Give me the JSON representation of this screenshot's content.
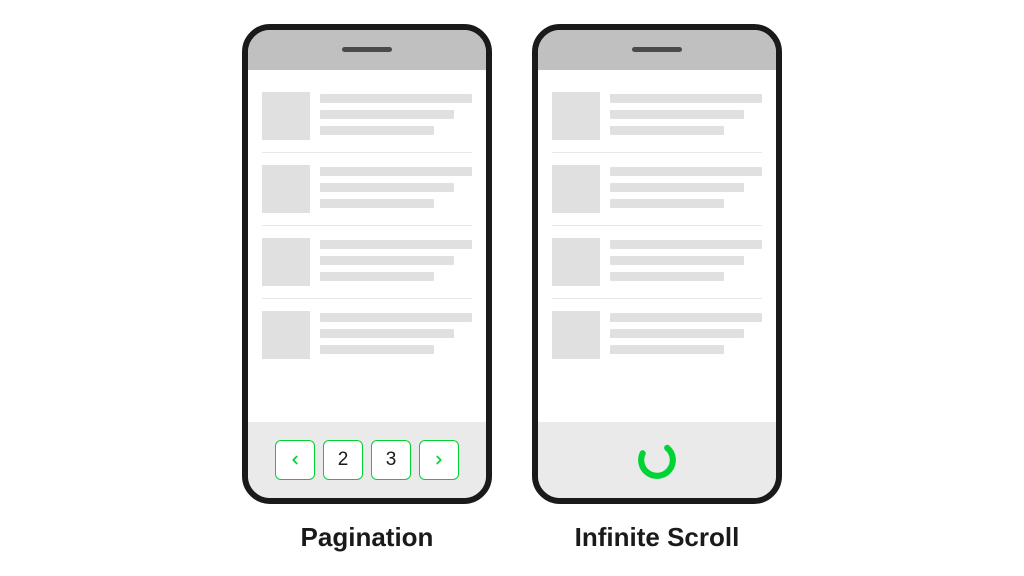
{
  "phones": {
    "pagination": {
      "label": "Pagination",
      "pages": {
        "page2": "2",
        "page3": "3"
      }
    },
    "infinite": {
      "label": "Infinite Scroll"
    }
  },
  "colors": {
    "accent": "#00d435",
    "frame": "#1a1a1a",
    "statusbar": "#c0c0c0",
    "placeholder": "#e0e0e0",
    "footer": "#eaeaea"
  },
  "icons": {
    "prev": "chevron-left-icon",
    "next": "chevron-right-icon",
    "loading": "spinner-icon"
  }
}
